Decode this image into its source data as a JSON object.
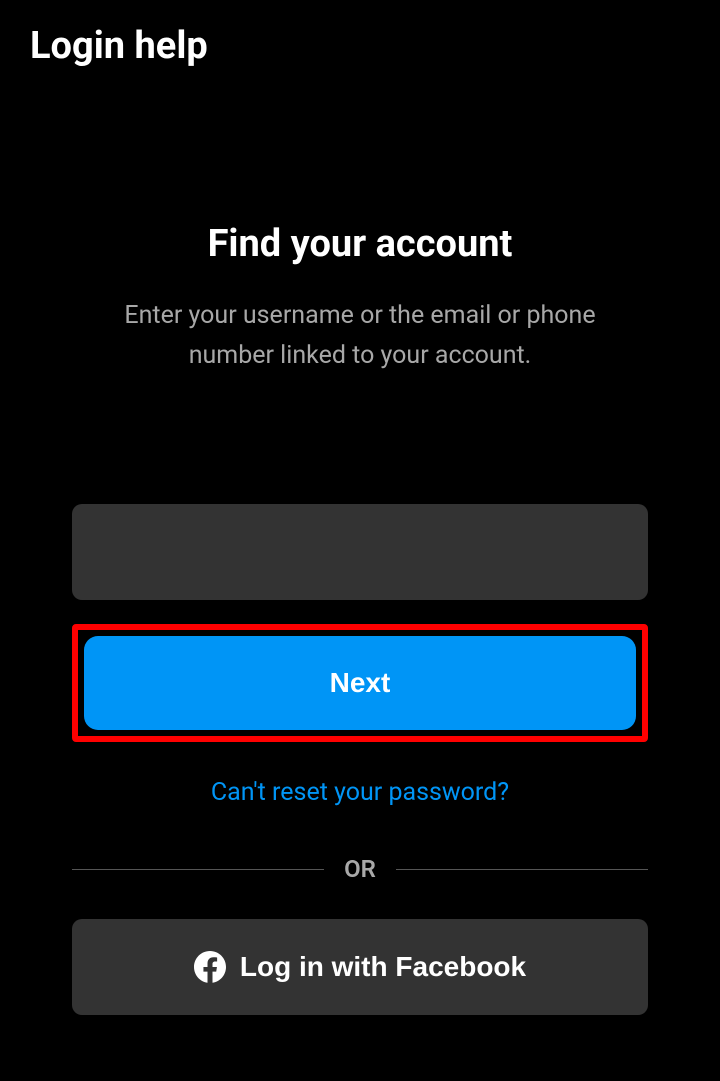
{
  "header": {
    "title": "Login help"
  },
  "main": {
    "heading": "Find your account",
    "subtitle": "Enter your username or the email or phone number linked to your account.",
    "next_button": "Next",
    "reset_link": "Can't reset your password?",
    "divider": "OR",
    "facebook_button": "Log in with Facebook"
  }
}
